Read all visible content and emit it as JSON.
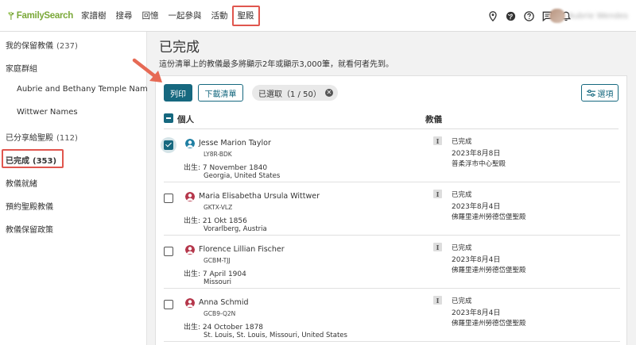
{
  "header": {
    "logo_text": "FamilySearch",
    "nav": [
      "家譜樹",
      "搜尋",
      "回憶",
      "一起參與",
      "活動",
      "聖殿"
    ],
    "active_nav": "聖殿",
    "user_name": "Aubrie Wendes",
    "icons": [
      "location-pin-icon",
      "globe-icon",
      "help-icon",
      "messages-icon",
      "bell-icon"
    ]
  },
  "sidebar": {
    "items": [
      {
        "label": "我的保留教儀",
        "count": "(237)"
      },
      {
        "label": "家庭群組",
        "count": ""
      },
      {
        "label": "Aubrie and Bethany Temple Names",
        "count": "",
        "sub": true
      },
      {
        "label": "Wittwer Names",
        "count": "",
        "sub": true
      },
      {
        "label": "已分享給聖殿",
        "count": "(112)"
      },
      {
        "label": "已完成",
        "count": "(353)",
        "active": true
      },
      {
        "label": "教儀就緒",
        "count": ""
      },
      {
        "label": "預約聖殿教儀",
        "count": ""
      },
      {
        "label": "教儀保留政策",
        "count": ""
      }
    ]
  },
  "main": {
    "title": "已完成",
    "description": "這份清單上的教儀最多將顯示2年或顯示3,000筆，就看何者先到。",
    "toolbar": {
      "print_label": "列印",
      "download_label": "下載清單",
      "selected_chip": "已選取（1 / 50）",
      "options_label": "選項"
    },
    "columns": {
      "person": "個人",
      "ordinance": "教儀"
    },
    "rows": [
      {
        "name": "Jesse Marion Taylor",
        "pid": "LY8R-BDK",
        "gender": "male",
        "birth_label": "出生:",
        "birth_date": "7 November 1840",
        "birth_place": "Georgia, United States",
        "ordinance_type": "I",
        "status": "已完成",
        "date": "2023年8月8日",
        "temple": "普柔浮市中心聖殿",
        "checked": true
      },
      {
        "name": "Maria Elisabetha Ursula Wittwer",
        "pid": "GKTX-VLZ",
        "gender": "female",
        "birth_label": "出生:",
        "birth_date": "21 Okt 1856",
        "birth_place": "Vorarlberg, Austria",
        "ordinance_type": "I",
        "status": "已完成",
        "date": "2023年8月4日",
        "temple": "佛羅里達州勞德岱堡聖殿",
        "checked": false
      },
      {
        "name": "Florence Lillian Fischer",
        "pid": "GCBM-TJJ",
        "gender": "female",
        "birth_label": "出生:",
        "birth_date": "7 April 1904",
        "birth_place": "Missouri",
        "ordinance_type": "I",
        "status": "已完成",
        "date": "2023年8月4日",
        "temple": "佛羅里達州勞德岱堡聖殿",
        "checked": false
      },
      {
        "name": "Anna Schmid",
        "pid": "GCB9-Q2N",
        "gender": "female",
        "birth_label": "出生:",
        "birth_date": "24 October 1878",
        "birth_place": "St. Louis, St. Louis, Missouri, United States",
        "ordinance_type": "I",
        "status": "已完成",
        "date": "2023年8月4日",
        "temple": "佛羅里達州勞德岱堡聖殿",
        "checked": false
      }
    ]
  },
  "colors": {
    "accent": "#16687f",
    "highlight": "#e0564e",
    "logo_green": "#7aa838",
    "male": "#1f7fa3",
    "female": "#b5374b"
  }
}
